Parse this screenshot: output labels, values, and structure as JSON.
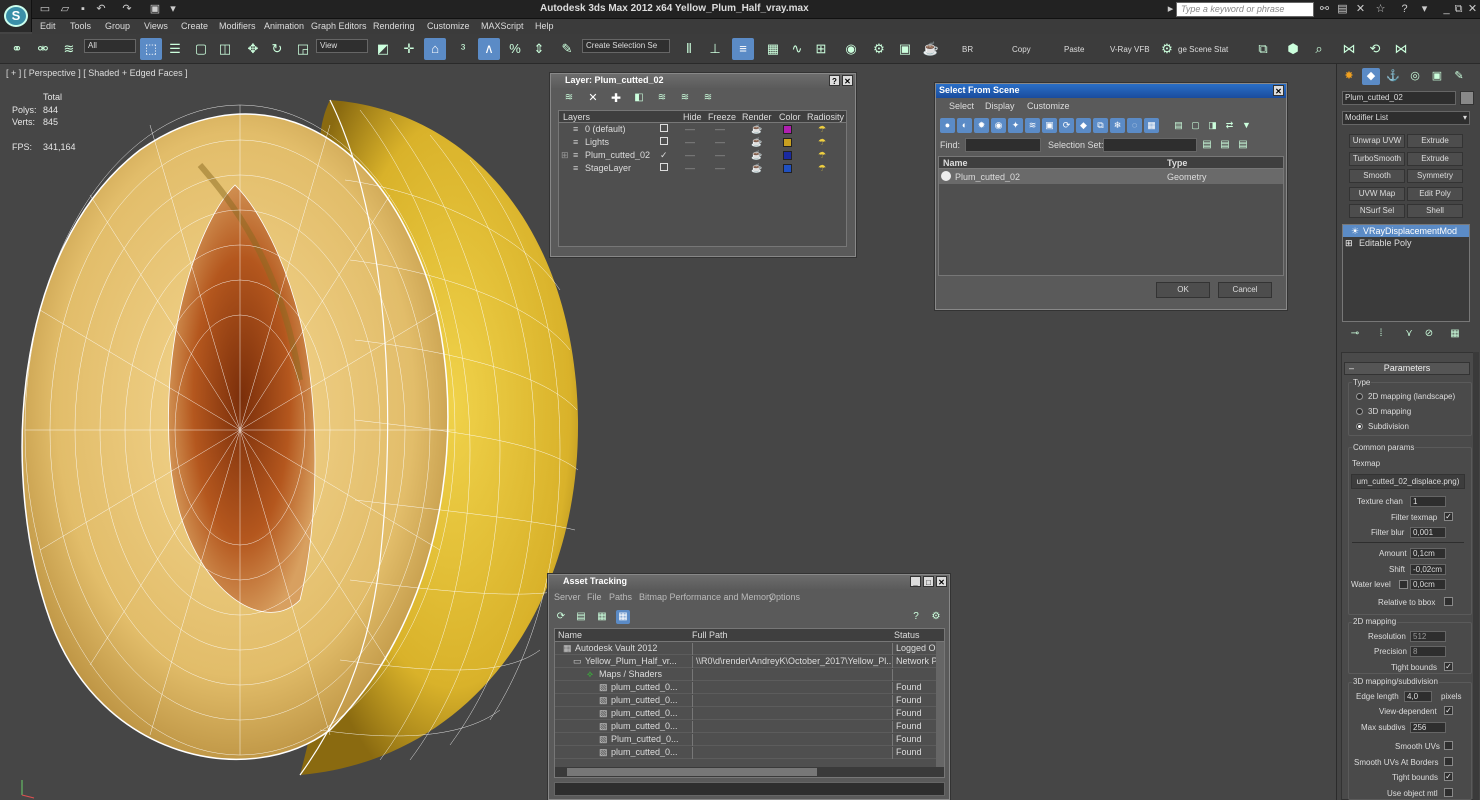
{
  "app": {
    "title": "Autodesk 3ds Max  2012 x64     Yellow_Plum_Half_vray.max",
    "search_placeholder": "Type a keyword or phrase",
    "logo_letter": "S"
  },
  "menu": [
    "Edit",
    "Tools",
    "Group",
    "Views",
    "Create",
    "Modifiers",
    "Animation",
    "Graph Editors",
    "Rendering",
    "Customize",
    "MAXScript",
    "Help"
  ],
  "toolbar": {
    "selection_filter": "All",
    "ref_coord": "View",
    "named_selection": "Create Selection Se",
    "text_buttons": [
      "BR",
      "Copy",
      "Paste",
      "V-Ray VFB",
      "ge Scene Stat"
    ]
  },
  "viewport": {
    "label": "[ + ] [ Perspective ] [ Shaded + Edged Faces ]",
    "stats": {
      "total_label": "Total",
      "polys_label": "Polys:",
      "polys": "844",
      "verts_label": "Verts:",
      "verts": "845",
      "fps_label": "FPS:",
      "fps": "341,164"
    }
  },
  "layer_window": {
    "title": "Layer: Plum_cutted_02",
    "columns": [
      "Layers",
      "Hide",
      "Freeze",
      "Render",
      "Color",
      "Radiosity"
    ],
    "rows": [
      {
        "name": "0 (default)",
        "color": "#b01fb0",
        "current": false
      },
      {
        "name": "Lights",
        "color": "#c8a020",
        "current": false
      },
      {
        "name": "Plum_cutted_02",
        "color": "#1a2aa0",
        "current": true
      },
      {
        "name": "StageLayer",
        "color": "#2050c0",
        "current": false
      }
    ]
  },
  "select_window": {
    "title": "Select From Scene",
    "menu": [
      "Select",
      "Display",
      "Customize"
    ],
    "find_label": "Find:",
    "selset_label": "Selection Set:",
    "columns": [
      "Name",
      "Type"
    ],
    "rows": [
      {
        "name": "Plum_cutted_02",
        "type": "Geometry"
      }
    ],
    "ok": "OK",
    "cancel": "Cancel"
  },
  "asset_window": {
    "title": "Asset Tracking",
    "menu": [
      "Server",
      "File",
      "Paths",
      "Bitmap Performance and Memory",
      "Options"
    ],
    "columns": [
      "Name",
      "Full Path",
      "Status"
    ],
    "rows": [
      {
        "name": "Autodesk Vault 2012",
        "path": "",
        "status": "Logged Ou"
      },
      {
        "name": "Yellow_Plum_Half_vr...",
        "path": "\\\\R0\\d\\render\\AndreyK\\October_2017\\Yellow_Pl...",
        "status": "Network Pa"
      },
      {
        "name": "Maps / Shaders",
        "path": "",
        "status": ""
      },
      {
        "name": "plum_cutted_0...",
        "path": "",
        "status": "Found"
      },
      {
        "name": "plum_cutted_0...",
        "path": "",
        "status": "Found"
      },
      {
        "name": "plum_cutted_0...",
        "path": "",
        "status": "Found"
      },
      {
        "name": "plum_cutted_0...",
        "path": "",
        "status": "Found"
      },
      {
        "name": "Plum_cutted_0...",
        "path": "",
        "status": "Found"
      },
      {
        "name": "plum_cutted_0...",
        "path": "",
        "status": "Found"
      }
    ]
  },
  "command_panel": {
    "object_name": "Plum_cutted_02",
    "modifier_list": "Modifier List",
    "mod_buttons": [
      "Unwrap UVW",
      "Extrude",
      "TurboSmooth",
      "Extrude",
      "Smooth",
      "Symmetry",
      "UVW Map",
      "Edit Poly",
      "NSurf Sel",
      "Shell"
    ],
    "stack": [
      "VRayDisplacementMod",
      "Editable Poly"
    ],
    "params": {
      "rollout": "Parameters",
      "type_label": "Type",
      "type_options": [
        "2D mapping (landscape)",
        "3D mapping",
        "Subdivision"
      ],
      "type_selected": 2,
      "common_label": "Common params",
      "texmap_label": "Texmap",
      "texmap": "um_cutted_02_displace.png)",
      "texture_chan_label": "Texture chan",
      "texture_chan": "1",
      "filter_texmap_label": "Filter texmap",
      "filter_blur_label": "Filter blur",
      "filter_blur": "0,001",
      "amount_label": "Amount",
      "amount": "0,1cm",
      "shift_label": "Shift",
      "shift": "-0,02cm",
      "water_label": "Water level",
      "water": "0,0cm",
      "relative_label": "Relative to bbox",
      "map2d_label": "2D mapping",
      "resolution_label": "Resolution",
      "resolution": "512",
      "precision_label": "Precision",
      "precision": "8",
      "tight1_label": "Tight bounds",
      "map3d_label": "3D mapping/subdivision",
      "edge_label": "Edge length",
      "edge": "4,0",
      "pixels_label": "pixels",
      "viewdep_label": "View-dependent",
      "maxsub_label": "Max subdivs",
      "maxsub": "256",
      "smoothuv_label": "Smooth UVs",
      "smoothuvb_label": "Smooth UVs At Borders",
      "tight2_label": "Tight bounds",
      "useobj_label": "Use object mtl"
    }
  }
}
